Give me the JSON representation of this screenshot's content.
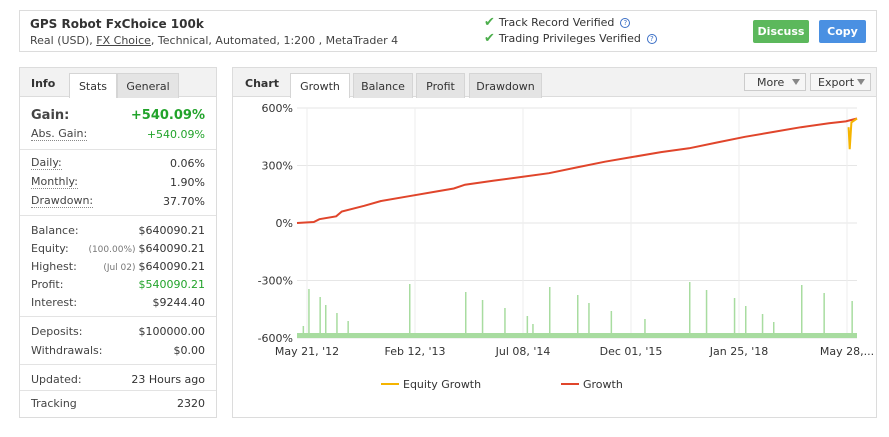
{
  "header": {
    "title": "GPS Robot FxChoice 100k",
    "subtitle_prefix": "Real (USD), ",
    "subtitle_link": "FX Choice",
    "subtitle_suffix": ", Technical, Automated, 1:200 , MetaTrader 4",
    "verified": [
      "Track Record Verified",
      "Trading Privileges Verified"
    ],
    "help_glyph": "?",
    "check_glyph": "✔",
    "discuss_label": "Discuss",
    "copy_label": "Copy"
  },
  "left_tabs": {
    "info": "Info",
    "stats": "Stats",
    "general": "General"
  },
  "stats": {
    "gain_label": "Gain:",
    "gain_value": "+540.09%",
    "abs_gain_label": "Abs. Gain:",
    "abs_gain_value": "+540.09%",
    "daily_label": "Daily:",
    "daily_value": "0.06%",
    "monthly_label": "Monthly:",
    "monthly_value": "1.90%",
    "drawdown_label": "Drawdown:",
    "drawdown_value": "37.70%",
    "balance_label": "Balance:",
    "balance_value": "$640090.21",
    "equity_label": "Equity:",
    "equity_sub": "(100.00%)",
    "equity_value": "$640090.21",
    "highest_label": "Highest:",
    "highest_sub": "(Jul 02)",
    "highest_value": "$640090.21",
    "profit_label": "Profit:",
    "profit_value": "$540090.21",
    "interest_label": "Interest:",
    "interest_value": "$9244.40",
    "deposits_label": "Deposits:",
    "deposits_value": "$100000.00",
    "withdrawals_label": "Withdrawals:",
    "withdrawals_value": "$0.00",
    "updated_label": "Updated:",
    "updated_value": "23 Hours ago",
    "tracking_label": "Tracking",
    "tracking_value": "2320"
  },
  "chart_tabs": {
    "chart": "Chart",
    "growth": "Growth",
    "balance": "Balance",
    "profit": "Profit",
    "drawdown": "Drawdown",
    "more": "More",
    "export": "Export"
  },
  "colors": {
    "growth": "#e0452b",
    "equity": "#f5b400",
    "volume": "#a8dca0",
    "green_text": "#22a32b",
    "discuss": "#5cb85c",
    "copy": "#4a90e2"
  },
  "chart_data": {
    "type": "line",
    "yticks": [
      "600%",
      "300%",
      "0%",
      "-300%",
      "-600%"
    ],
    "ylim": [
      -600,
      600
    ],
    "xticks": [
      "May 21, '12",
      "Feb 12, '13",
      "Jul 08, '14",
      "Dec 01, '15",
      "Jan 25, '18",
      "May 28,..."
    ],
    "series": [
      {
        "name": "Growth",
        "points": [
          [
            0,
            0
          ],
          [
            0.03,
            5
          ],
          [
            0.04,
            20
          ],
          [
            0.07,
            35
          ],
          [
            0.08,
            60
          ],
          [
            0.12,
            90
          ],
          [
            0.15,
            115
          ],
          [
            0.2,
            140
          ],
          [
            0.25,
            165
          ],
          [
            0.28,
            180
          ],
          [
            0.3,
            200
          ],
          [
            0.35,
            220
          ],
          [
            0.4,
            240
          ],
          [
            0.45,
            260
          ],
          [
            0.5,
            290
          ],
          [
            0.55,
            320
          ],
          [
            0.6,
            345
          ],
          [
            0.65,
            370
          ],
          [
            0.7,
            390
          ],
          [
            0.75,
            420
          ],
          [
            0.8,
            450
          ],
          [
            0.85,
            475
          ],
          [
            0.9,
            500
          ],
          [
            0.95,
            520
          ],
          [
            0.98,
            530
          ],
          [
            1.0,
            545
          ]
        ]
      },
      {
        "name": "Equity Growth",
        "points": [
          [
            0.985,
            500
          ],
          [
            0.987,
            385
          ],
          [
            0.99,
            525
          ],
          [
            1.0,
            545
          ]
        ]
      }
    ],
    "volume_spikes": [
      0.01,
      0.02,
      0.04,
      0.05,
      0.07,
      0.09,
      0.2,
      0.3,
      0.33,
      0.37,
      0.41,
      0.42,
      0.45,
      0.5,
      0.52,
      0.56,
      0.62,
      0.7,
      0.73,
      0.78,
      0.8,
      0.83,
      0.85,
      0.9,
      0.94,
      0.99
    ]
  }
}
